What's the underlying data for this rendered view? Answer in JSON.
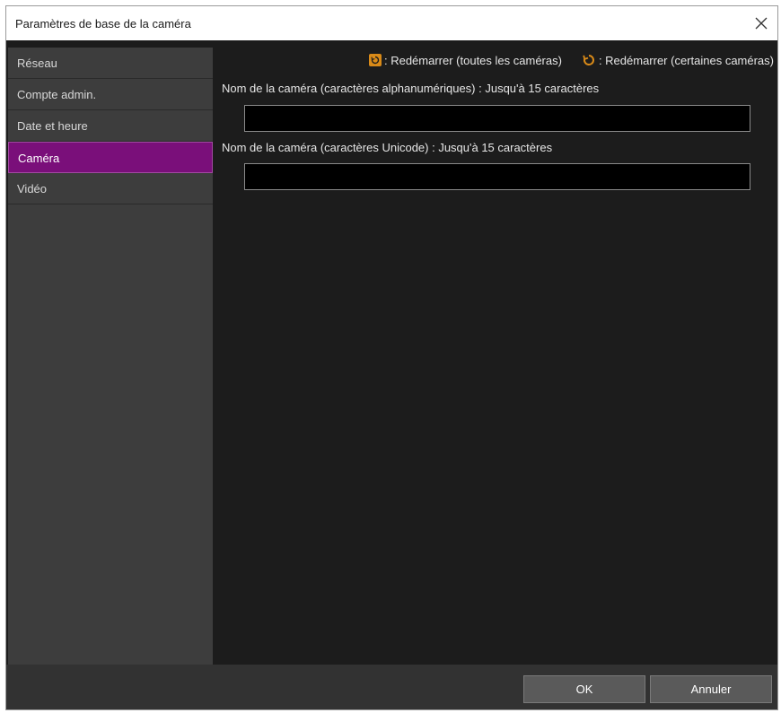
{
  "window": {
    "title": "Paramètres de base de la caméra"
  },
  "sidebar": {
    "items": [
      {
        "label": "Réseau"
      },
      {
        "label": "Compte admin."
      },
      {
        "label": "Date et heure"
      },
      {
        "label": "Caméra",
        "active": true
      },
      {
        "label": "Vidéo"
      }
    ]
  },
  "legend": {
    "restart_all": ": Redémarrer (toutes les caméras)",
    "restart_some": ": Redémarrer (certaines caméras)",
    "icons": [
      "restart-all-cameras-icon",
      "restart-some-cameras-icon"
    ],
    "icon_color": "#d98a18"
  },
  "fields": {
    "alnum_label": "Nom de la caméra (caractères alphanumériques) :  Jusqu'à 15 caractères",
    "alnum_value": "",
    "unicode_label": "Nom de la caméra (caractères Unicode) :  Jusqu'à 15 caractères",
    "unicode_value": ""
  },
  "footer": {
    "ok_label": "OK",
    "cancel_label": "Annuler"
  },
  "colors": {
    "accent": "#7a0f7a",
    "background": "#1c1c1c",
    "sidebar": "#3d3d3d"
  }
}
